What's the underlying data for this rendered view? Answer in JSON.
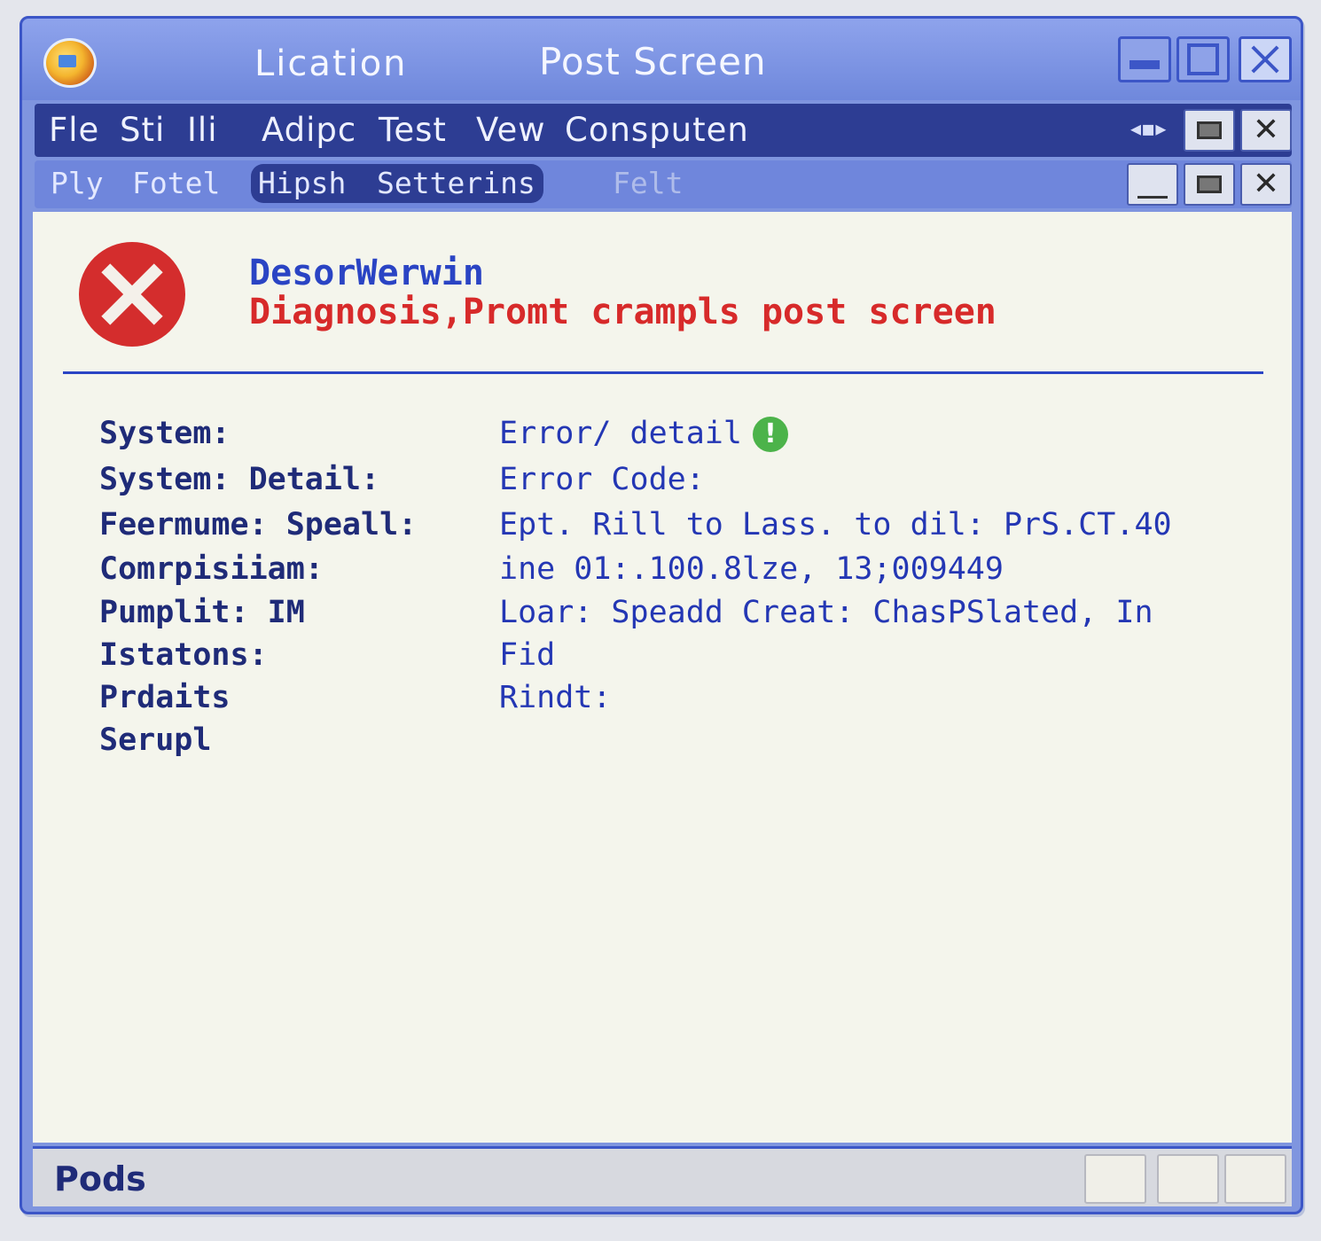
{
  "window": {
    "title_left": "Lication",
    "title": "Post Screen"
  },
  "menu": {
    "items": [
      "Fle",
      "Sti",
      "Ili",
      "Adipc",
      "Test",
      "Vew",
      "Consputen"
    ],
    "nav_arrows": "◂▪▸"
  },
  "toolbar": {
    "items": [
      "Ply",
      "Fotel",
      "Hipsh",
      "Setterins",
      "Felt"
    ],
    "selected_index": 2
  },
  "header": {
    "title": "DesorWerwin",
    "subtitle": "Diagnosis,Promt crampls post screen"
  },
  "details": [
    {
      "label": "System:",
      "value": "Error/ detail",
      "status_icon": "check-circle-icon"
    },
    {
      "label": "System: Detail:",
      "value": "Error Code:"
    },
    {
      "label": "Feermume: Speall:",
      "value": "Ept. Rill to  Lass. to dil: PrS.CT.40"
    },
    {
      "label": "Comrpisiiam:",
      "value": "ine 01:.100.8lze, 13;009449"
    },
    {
      "label": "Pumplit: IM",
      "value": "Loar: Speadd Creat: ChasPSlated, In"
    },
    {
      "label": "Istatons:",
      "value": "Fid"
    },
    {
      "label": "Prdaits",
      "value": "Rindt:"
    },
    {
      "label": "Serupl",
      "value": ""
    }
  ],
  "statusbar": {
    "text": "Pods"
  },
  "colors": {
    "titlebar": "#7f95df",
    "menubar": "#2d3d93",
    "error_red": "#d42d2d",
    "text_blue": "#2437b4"
  }
}
